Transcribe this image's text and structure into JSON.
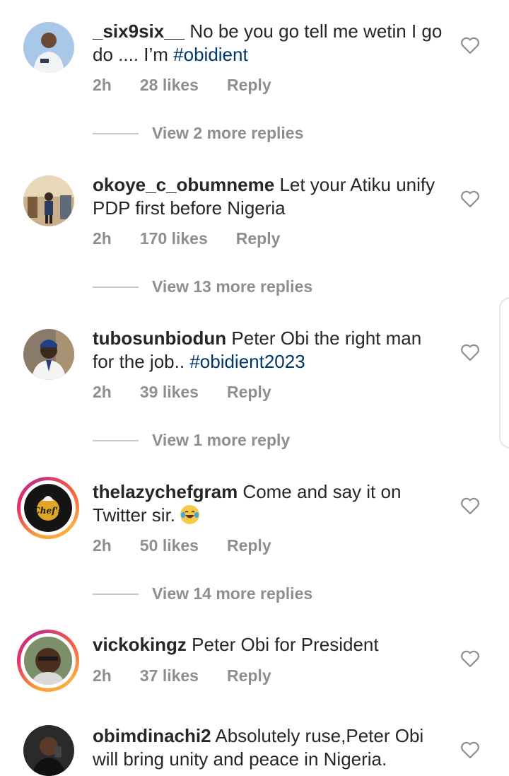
{
  "comments": [
    {
      "username": "_six9six__",
      "text": " No be you go tell me wetin I go do .... I’m ",
      "hashtag": "#obidient",
      "time": "2h",
      "likes": "28 likes",
      "reply": "Reply",
      "view_more": "View 2 more replies",
      "story_ring": false
    },
    {
      "username": "okoye_c_obumneme",
      "text": " Let your Atiku unify PDP first before Nigeria",
      "hashtag": "",
      "time": "2h",
      "likes": "170 likes",
      "reply": "Reply",
      "view_more": "View 13 more replies",
      "story_ring": false
    },
    {
      "username": "tubosunbiodun",
      "text": " Peter Obi the right man for the job.. ",
      "hashtag": "#obidient2023",
      "time": "2h",
      "likes": "39 likes",
      "reply": "Reply",
      "view_more": "View 1 more reply",
      "story_ring": false
    },
    {
      "username": "thelazychefgram",
      "text": " Come and say it on Twitter sir. ",
      "hashtag": "",
      "time": "2h",
      "likes": "50 likes",
      "reply": "Reply",
      "view_more": "View 14 more replies",
      "story_ring": true,
      "avatar_text": "Chef's"
    },
    {
      "username": "vickokingz",
      "text": " Peter Obi for President",
      "hashtag": "",
      "time": "2h",
      "likes": "37 likes",
      "reply": "Reply",
      "view_more": "",
      "story_ring": true
    },
    {
      "username": "obimdinachi2",
      "text": " Absolutely ruse,Peter Obi will bring unity and peace in Nigeria.",
      "hashtag": "",
      "time": "",
      "likes": "",
      "reply": "",
      "view_more": "",
      "story_ring": false
    }
  ],
  "colors": {
    "text": "#262626",
    "meta": "#8e8e8e",
    "hashtag": "#00376b",
    "divider": "#c7c7c7"
  },
  "icons": {
    "like": "heart-outline-icon",
    "emoji": "laughing-tears-emoji"
  }
}
